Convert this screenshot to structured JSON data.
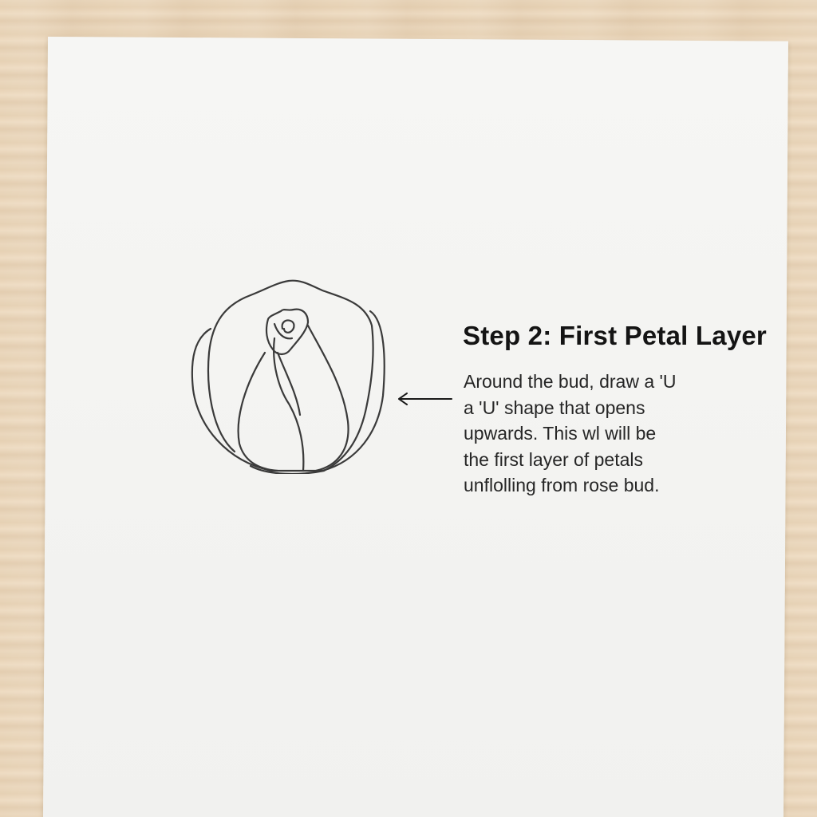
{
  "step": {
    "title": "Step 2: First Petal Layer",
    "lines": [
      "Around the bud, draw a 'U",
      "a 'U' shape that opens",
      "upwards. This wl will be",
      "the first layer of petals",
      "unflolling from rose bud."
    ]
  },
  "icons": {
    "arrow": "arrow-left-icon"
  },
  "colors": {
    "ink": "#3a3a3a",
    "paper": "#f4f4f2",
    "table": "#ead7bd"
  }
}
